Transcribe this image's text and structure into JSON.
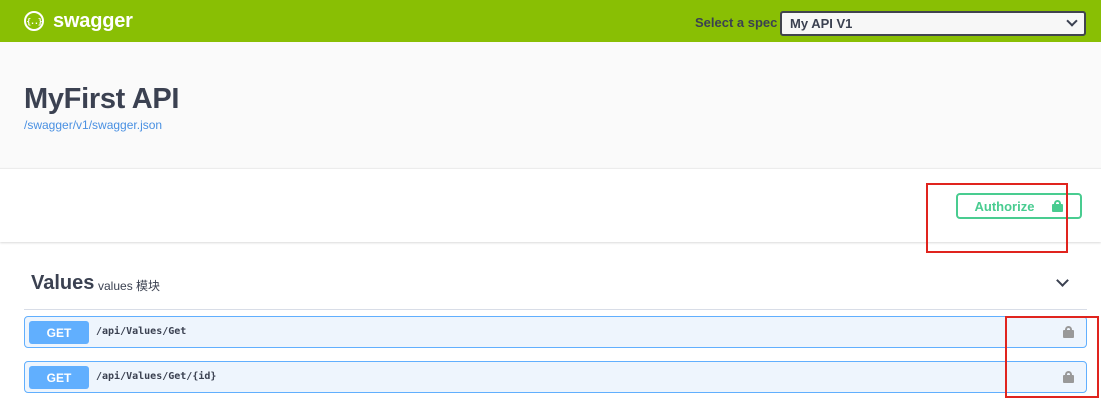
{
  "header": {
    "brand_name": "swagger",
    "brand_logo_glyph": "{..}",
    "spec_label": "Select a spec",
    "spec_selected": "My API V1",
    "bar_color": "#89bf04"
  },
  "info": {
    "title": "MyFirst API",
    "spec_url": "/swagger/v1/swagger.json"
  },
  "scheme": {
    "authorize_label": "Authorize",
    "authorize_color": "#49cc90"
  },
  "tag": {
    "name": "Values",
    "description": "values 模块"
  },
  "operations": [
    {
      "method": "GET",
      "path": "/api/Values/Get",
      "method_color": "#61affe"
    },
    {
      "method": "GET",
      "path": "/api/Values/Get/{id}",
      "method_color": "#61affe"
    }
  ],
  "annotation_color": "#e0241e"
}
